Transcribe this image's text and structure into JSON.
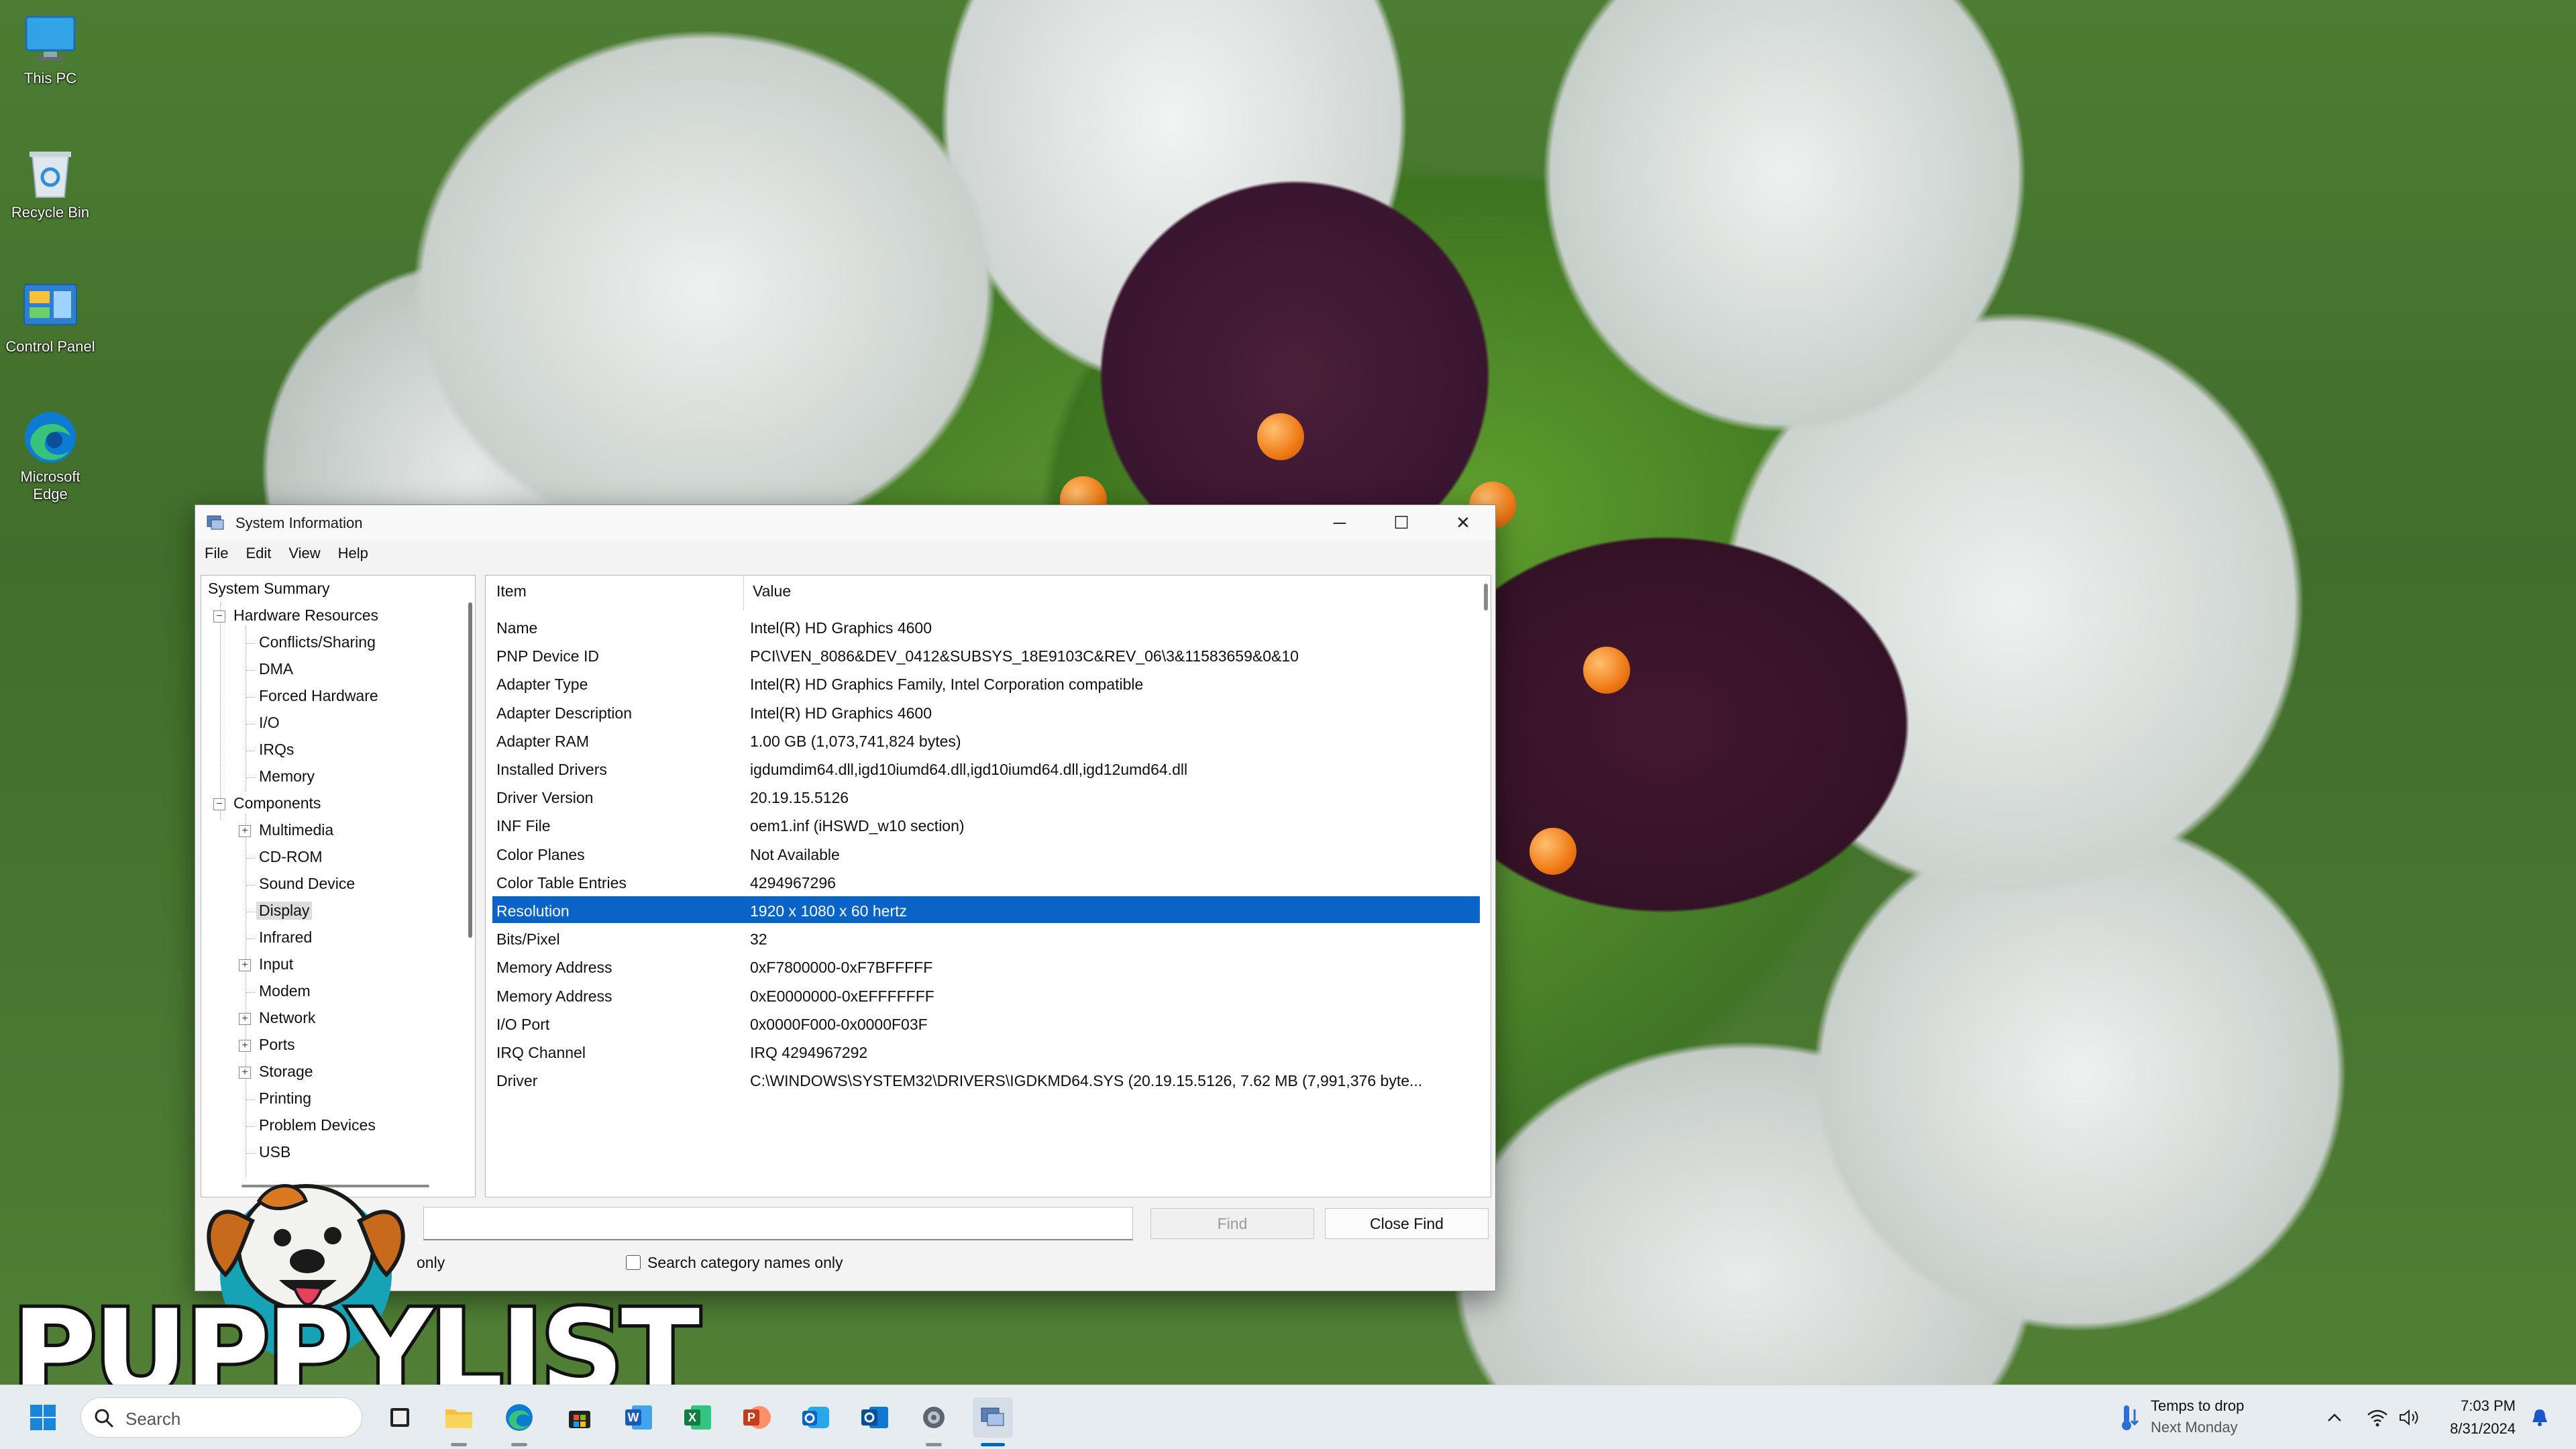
{
  "desktop": {
    "icons": [
      {
        "label": "This PC",
        "icon": "monitor-icon"
      },
      {
        "label": "Recycle Bin",
        "icon": "recycle-bin-icon"
      },
      {
        "label": "Control Panel",
        "icon": "control-panel-icon"
      },
      {
        "label": "Microsoft Edge",
        "icon": "edge-icon"
      }
    ]
  },
  "window": {
    "title": "System Information",
    "menu": [
      "File",
      "Edit",
      "View",
      "Help"
    ],
    "caption_buttons": {
      "minimize": "─",
      "maximize": "☐",
      "close": "✕"
    },
    "tree": {
      "root": "System Summary",
      "items": [
        {
          "label": "Hardware Resources",
          "level": 1,
          "toggle": "⊟"
        },
        {
          "label": "Conflicts/Sharing",
          "level": 2
        },
        {
          "label": "DMA",
          "level": 2
        },
        {
          "label": "Forced Hardware",
          "level": 2
        },
        {
          "label": "I/O",
          "level": 2
        },
        {
          "label": "IRQs",
          "level": 2
        },
        {
          "label": "Memory",
          "level": 2
        },
        {
          "label": "Components",
          "level": 1,
          "toggle": "⊟"
        },
        {
          "label": "Multimedia",
          "level": 2,
          "toggle": "⊞"
        },
        {
          "label": "CD-ROM",
          "level": 2
        },
        {
          "label": "Sound Device",
          "level": 2
        },
        {
          "label": "Display",
          "level": 2,
          "selected": true
        },
        {
          "label": "Infrared",
          "level": 2
        },
        {
          "label": "Input",
          "level": 2,
          "toggle": "⊞"
        },
        {
          "label": "Modem",
          "level": 2
        },
        {
          "label": "Network",
          "level": 2,
          "toggle": "⊞"
        },
        {
          "label": "Ports",
          "level": 2,
          "toggle": "⊞"
        },
        {
          "label": "Storage",
          "level": 2,
          "toggle": "⊞"
        },
        {
          "label": "Printing",
          "level": 2
        },
        {
          "label": "Problem Devices",
          "level": 2
        },
        {
          "label": "USB",
          "level": 2
        }
      ]
    },
    "details": {
      "columns": [
        "Item",
        "Value"
      ],
      "rows": [
        {
          "item": "Name",
          "value": "Intel(R) HD Graphics 4600"
        },
        {
          "item": "PNP Device ID",
          "value": "PCI\\VEN_8086&DEV_0412&SUBSYS_18E9103C&REV_06\\3&11583659&0&10"
        },
        {
          "item": "Adapter Type",
          "value": "Intel(R) HD Graphics Family, Intel Corporation compatible"
        },
        {
          "item": "Adapter Description",
          "value": "Intel(R) HD Graphics 4600"
        },
        {
          "item": "Adapter RAM",
          "value": "1.00 GB (1,073,741,824 bytes)"
        },
        {
          "item": "Installed Drivers",
          "value": "igdumdim64.dll,igd10iumd64.dll,igd10iumd64.dll,igd12umd64.dll"
        },
        {
          "item": "Driver Version",
          "value": "20.19.15.5126"
        },
        {
          "item": "INF File",
          "value": "oem1.inf (iHSWD_w10 section)"
        },
        {
          "item": "Color Planes",
          "value": "Not Available"
        },
        {
          "item": "Color Table Entries",
          "value": "4294967296"
        },
        {
          "item": "Resolution",
          "value": "1920 x 1080 x 60 hertz",
          "selected": true
        },
        {
          "item": "Bits/Pixel",
          "value": "32"
        },
        {
          "item": "Memory Address",
          "value": "0xF7800000-0xF7BFFFFF"
        },
        {
          "item": "Memory Address",
          "value": "0xE0000000-0xEFFFFFFF"
        },
        {
          "item": "I/O Port",
          "value": "0x0000F000-0x0000F03F"
        },
        {
          "item": "IRQ Channel",
          "value": "IRQ 4294967292"
        },
        {
          "item": "Driver",
          "value": "C:\\WINDOWS\\SYSTEM32\\DRIVERS\\IGDKMD64.SYS (20.19.15.5126, 7.62 MB (7,991,376 byte..."
        }
      ]
    },
    "find": {
      "input_value": "",
      "find_button": "Find",
      "close_find_button": "Close Find",
      "checkbox_selected_label": "only",
      "checkbox_category_label": "Search category names only"
    }
  },
  "watermark": {
    "text": "PUPPYLIST"
  },
  "taskbar": {
    "search_placeholder": "Search",
    "apps": [
      "start-icon",
      "search",
      "task-view-icon",
      "file-explorer-icon",
      "edge-icon",
      "store-icon",
      "word-icon",
      "excel-icon",
      "powerpoint-icon",
      "outlook-new-icon",
      "outlook-icon",
      "settings-icon",
      "system-information-icon"
    ],
    "weather_line1": "Temps to drop",
    "weather_line2": "Next Monday",
    "time": "7:03 PM",
    "date": "8/31/2024"
  },
  "colors": {
    "selection": "#0a64c8",
    "taskbar": "#e7ecf1",
    "accent": "#0067c0"
  }
}
